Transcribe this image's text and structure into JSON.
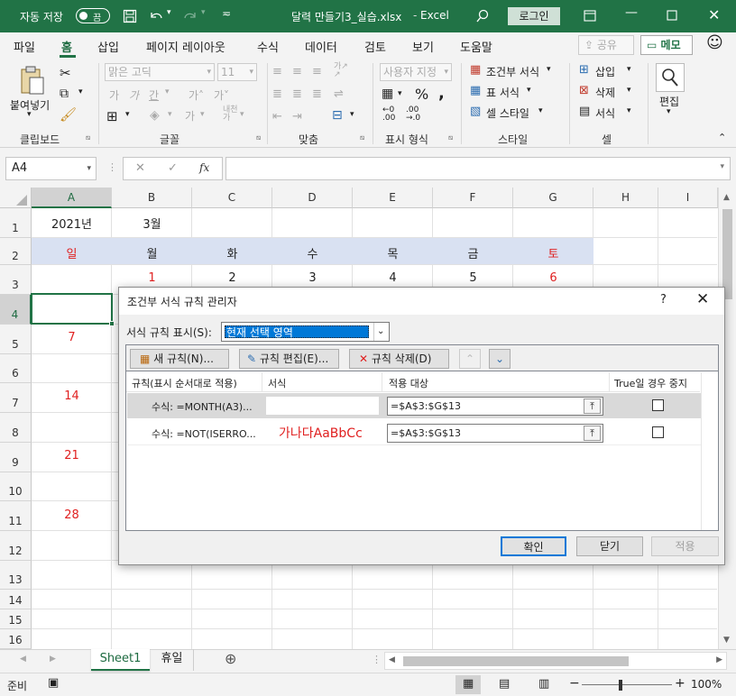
{
  "titlebar": {
    "autosave_label": "자동 저장",
    "autosave_state": "끔",
    "file_title": "달력 만들기3_실습.xlsx",
    "app_name": "Excel",
    "login_label": "로그인",
    "accent_color": "#217346"
  },
  "menu": {
    "tabs": [
      "파일",
      "홈",
      "삽입",
      "페이지 레이아웃",
      "수식",
      "데이터",
      "검토",
      "보기",
      "도움말"
    ],
    "active_tab": "홈",
    "share_label": "공유",
    "memo_label": "메모"
  },
  "ribbon": {
    "paste_label": "붙여넣기",
    "font_name": "맑은 고딕",
    "font_size": "11",
    "number_format": "사용자 지정",
    "conditional_format_label": "조건부 서식",
    "table_format_label": "표 서식",
    "cell_style_label": "셀 스타일",
    "insert_label": "삽입",
    "delete_label": "삭제",
    "format_label": "서식",
    "edit_label": "편집",
    "groups": [
      "클립보드",
      "글꼴",
      "맞춤",
      "표시 형식",
      "스타일",
      "셀"
    ]
  },
  "formula_bar": {
    "name_box": "A4",
    "formula": ""
  },
  "sheet": {
    "columns": [
      "A",
      "B",
      "C",
      "D",
      "E",
      "F",
      "G",
      "H",
      "I"
    ],
    "rows": [
      "1",
      "2",
      "3",
      "4",
      "5",
      "6",
      "7",
      "8",
      "9",
      "10",
      "11",
      "12",
      "13",
      "14",
      "15",
      "16"
    ],
    "year_cell": "2021년",
    "month_cell": "3월",
    "weekdays": [
      "일",
      "월",
      "화",
      "수",
      "목",
      "금",
      "토"
    ],
    "row3_values": [
      "1",
      "2",
      "3",
      "4",
      "5",
      "6"
    ],
    "colA_values": [
      "7",
      "14",
      "21",
      "28"
    ],
    "weekday_band_color": "#d9e1f2",
    "red_color": "#e02020"
  },
  "dialog": {
    "title": "조건부 서식 규칙 관리자",
    "help": "?",
    "show_rules_label": "서식 규칙 표시(S):",
    "show_rules_value": "현재 선택 영역",
    "new_rule": "새 규칙(N)...",
    "edit_rule": "규칙 편집(E)...",
    "delete_rule": "규칙 삭제(D)",
    "headers": [
      "규칙(표시 순서대로 적용)",
      "서식",
      "적용 대상",
      "True일 경우 중지"
    ],
    "rules": [
      {
        "rule": "수식: =MONTH(A3)...",
        "preview": "",
        "applies_to": "=$A$3:$G$13"
      },
      {
        "rule": "수식: =NOT(ISERRO...",
        "preview": "가나다AaBbCc",
        "applies_to": "=$A$3:$G$13"
      }
    ],
    "ok": "확인",
    "close": "닫기",
    "apply": "적용"
  },
  "sheet_tabs": {
    "tabs": [
      "Sheet1",
      "휴일"
    ],
    "active": "Sheet1"
  },
  "status": {
    "ready": "준비",
    "zoom": "100%"
  }
}
